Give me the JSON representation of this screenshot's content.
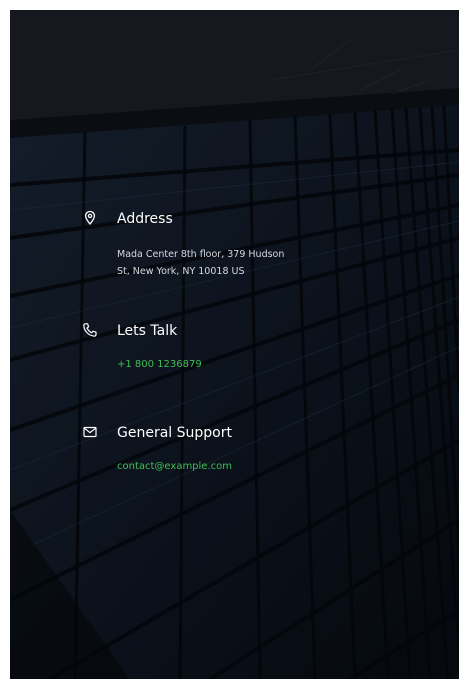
{
  "contact": {
    "address": {
      "icon": "map-pin-icon",
      "title": "Address",
      "line1": "Mada Center 8th floor, 379 Hudson",
      "line2": "St, New York, NY 10018 US"
    },
    "talk": {
      "icon": "phone-icon",
      "title": "Lets Talk",
      "phone": "+1 800 1236879"
    },
    "support": {
      "icon": "envelope-icon",
      "title": "General Support",
      "email": "contact@example.com"
    }
  },
  "colors": {
    "accent": "#3fbd55",
    "heading": "#ffffff",
    "body_text": "#d6d9de",
    "background": "#07090d"
  }
}
